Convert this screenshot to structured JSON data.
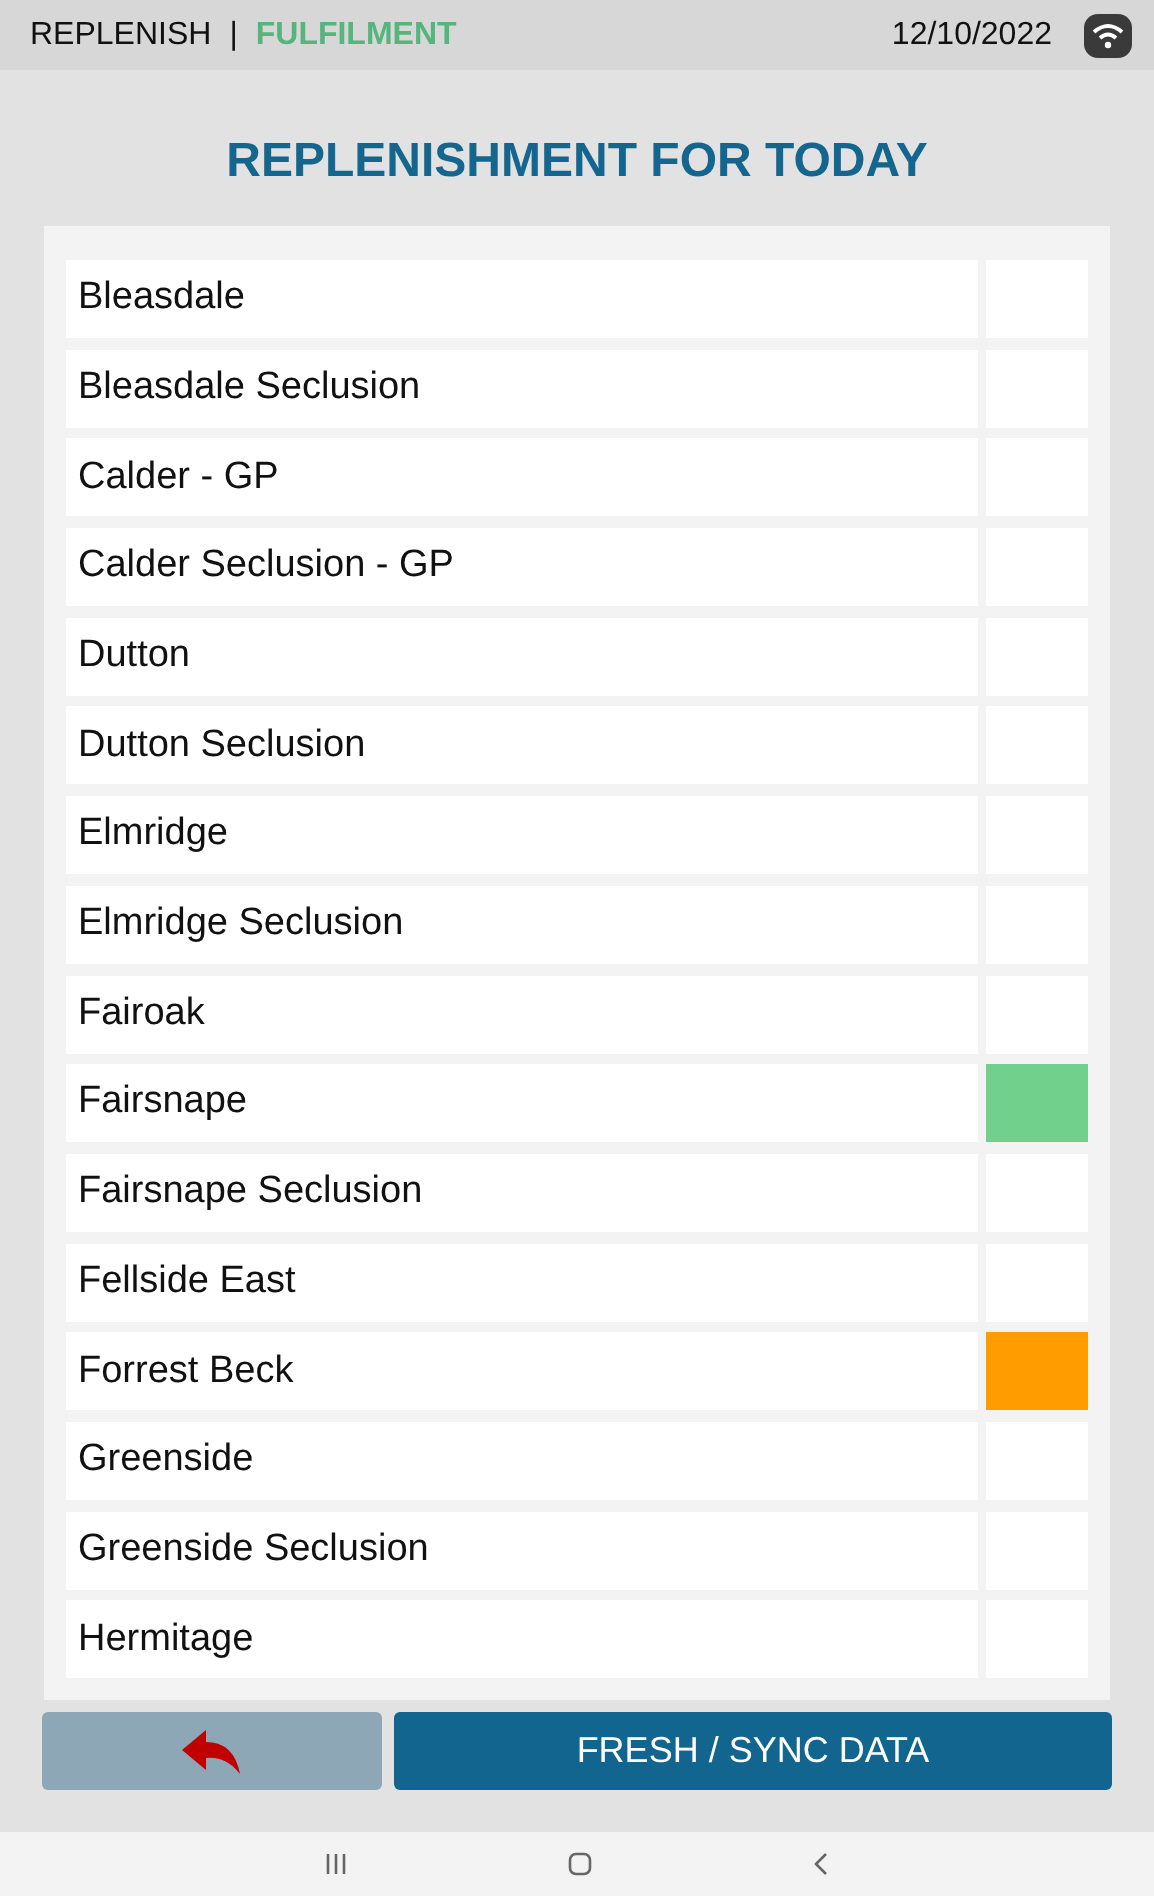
{
  "status_bar": {
    "app": "REPLENISH",
    "separator": "|",
    "mode": "FULFILMENT",
    "date": "12/10/2022"
  },
  "title": "REPLENISHMENT FOR TODAY",
  "locations": [
    {
      "name": "Bleasdale"
    },
    {
      "name": "Bleasdale Seclusion"
    },
    {
      "name": "Calder - GP"
    },
    {
      "name": "Calder Seclusion - GP"
    },
    {
      "name": "Dutton"
    },
    {
      "name": "Dutton Seclusion"
    },
    {
      "name": "Elmridge"
    },
    {
      "name": "Elmridge Seclusion"
    },
    {
      "name": "Fairoak"
    },
    {
      "name": "Fairsnape",
      "color": "#70d08c"
    },
    {
      "name": "Fairsnape Seclusion"
    },
    {
      "name": "Fellside East"
    },
    {
      "name": "Forrest Beck",
      "color": "#ff9c00"
    },
    {
      "name": "Greenside"
    },
    {
      "name": "Greenside Seclusion"
    },
    {
      "name": "Hermitage"
    }
  ],
  "buttons": {
    "sync": "FRESH / SYNC DATA"
  }
}
